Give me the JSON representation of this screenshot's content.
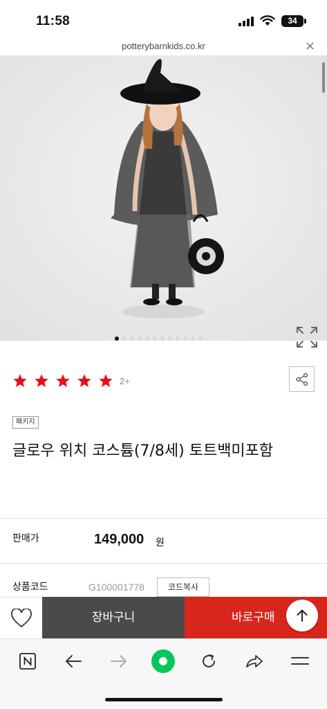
{
  "status": {
    "time": "11:58",
    "battery": "34"
  },
  "browser": {
    "url": "potterybarnkids.co.kr"
  },
  "product": {
    "rating_count": "2+",
    "badge": "패키지",
    "title": "글로우 위치 코스튬(7/8세) 토트백미포함",
    "price_label": "판매가",
    "price": "149,000",
    "price_unit": "원",
    "code_label": "상품코드",
    "code": "G100001778",
    "code_copy_label": "코드복사",
    "stars": 5
  },
  "actions": {
    "cart_label": "장바구니",
    "buy_label": "바로구매"
  },
  "carousel": {
    "total_slides": 12,
    "active_index": 0
  },
  "colors": {
    "accent_red": "#d9261c",
    "star_red": "#e5101a",
    "cart_gray": "#4a4a4a",
    "naver_green": "#03c75a"
  },
  "icons": {
    "close": "close-icon",
    "expand": "expand-icon",
    "share": "share-icon",
    "heart": "heart-icon",
    "arrow_up": "arrow-up-icon"
  }
}
